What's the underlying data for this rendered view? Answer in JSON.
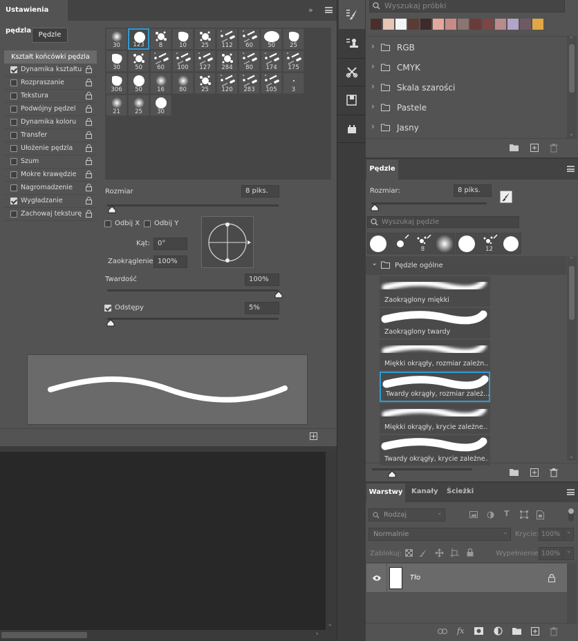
{
  "brush_settings": {
    "title": "Ustawienia pędzla",
    "brushes_button": "Pędzle",
    "tip_shape_header": "Kształt końcówki pędzla",
    "options": [
      {
        "label": "Dynamika kształtu",
        "checked": true
      },
      {
        "label": "Rozpraszanie",
        "checked": false
      },
      {
        "label": "Tekstura",
        "checked": false
      },
      {
        "label": "Podwójny pędzel",
        "checked": false
      },
      {
        "label": "Dynamika koloru",
        "checked": false
      },
      {
        "label": "Transfer",
        "checked": false
      },
      {
        "label": "Ułożenie pędzla",
        "checked": false
      },
      {
        "label": "Szum",
        "checked": false
      },
      {
        "label": "Mokre krawędzie",
        "checked": false
      },
      {
        "label": "Nagromadzenie",
        "checked": false
      },
      {
        "label": "Wygładzanie",
        "checked": true
      },
      {
        "label": "Zachowaj teksturę",
        "checked": false
      }
    ],
    "brush_sizes": [
      "30",
      "123",
      "8",
      "10",
      "25",
      "112",
      "60",
      "50",
      "25",
      "30",
      "50",
      "60",
      "100",
      "127",
      "284",
      "80",
      "174",
      "175",
      "306",
      "50",
      "16",
      "80",
      "25",
      "120",
      "283",
      "105",
      "3",
      "21",
      "25",
      "30"
    ],
    "size_label": "Rozmiar",
    "size_value": "8 piks.",
    "size_fraction": 0.03,
    "flip_x": "Odbij X",
    "flip_y": "Odbij Y",
    "angle_label": "Kąt:",
    "angle_value": "0°",
    "roundness_label": "Zaokrąglenie:",
    "roundness_value": "100%",
    "hardness_label": "Twardość",
    "hardness_value": "100%",
    "hardness_fraction": 1.0,
    "spacing_label": "Odstępy",
    "spacing_value": "5%",
    "spacing_checked": true,
    "spacing_fraction": 0.02
  },
  "toolstrip": {
    "icons": [
      "brush-settings-icon",
      "clone-source-icon",
      "tool-presets-icon",
      "notes-icon",
      "actions-icon"
    ]
  },
  "swatches": {
    "search_placeholder": "Wyszukaj próbki",
    "colors": [
      "#4a2e2c",
      "#e8c4b4",
      "#f4f4f4",
      "#5a3c35",
      "#3d2a2a",
      "#e2a89a",
      "#c88a86",
      "#8c7570",
      "#6b3b3b",
      "#7a4646",
      "#b88a8e",
      "#b2a3c8",
      "#6e5a63",
      "#e0a844"
    ],
    "folders": [
      "RGB",
      "CMYK",
      "Skala szarości",
      "Pastele",
      "Jasny"
    ]
  },
  "brushes_panel": {
    "tab": "Pędzle",
    "size_label": "Rozmiar:",
    "size_value": "8 piks.",
    "size_fraction": 0.03,
    "search_placeholder": "Wyszukaj pędzle",
    "recent_sizes": [
      "",
      "",
      "8",
      "",
      "",
      "12",
      ""
    ],
    "group_name": "Pędzle ogólne",
    "items": [
      {
        "name": "Zaokrąglony miękki",
        "selected": false
      },
      {
        "name": "Zaokrąglony twardy",
        "selected": false
      },
      {
        "name": "Miękki okrągły, rozmiar zależn...",
        "selected": false
      },
      {
        "name": "Twardy okrągły, rozmiar zależ...",
        "selected": true
      },
      {
        "name": "Miękki okrągły, krycie zależne...",
        "selected": false
      },
      {
        "name": "Twardy okrągły, krycie zależne...",
        "selected": false
      }
    ],
    "preview_size_fraction": 0.2
  },
  "layers": {
    "tabs": [
      "Warstwy",
      "Kanały",
      "Ścieżki"
    ],
    "filter_kind": "Rodzaj",
    "blend_mode": "Normalnie",
    "opacity_label": "Krycie:",
    "opacity_value": "100%",
    "lock_label": "Zablokuj:",
    "fill_label": "Wypełnienie:",
    "fill_value": "100%",
    "items": [
      {
        "name": "Tło",
        "visible": true,
        "locked": true
      }
    ]
  },
  "colors": {
    "accent": "#2e9bd6",
    "panel_bg": "#535353",
    "dark_bg": "#282828"
  }
}
